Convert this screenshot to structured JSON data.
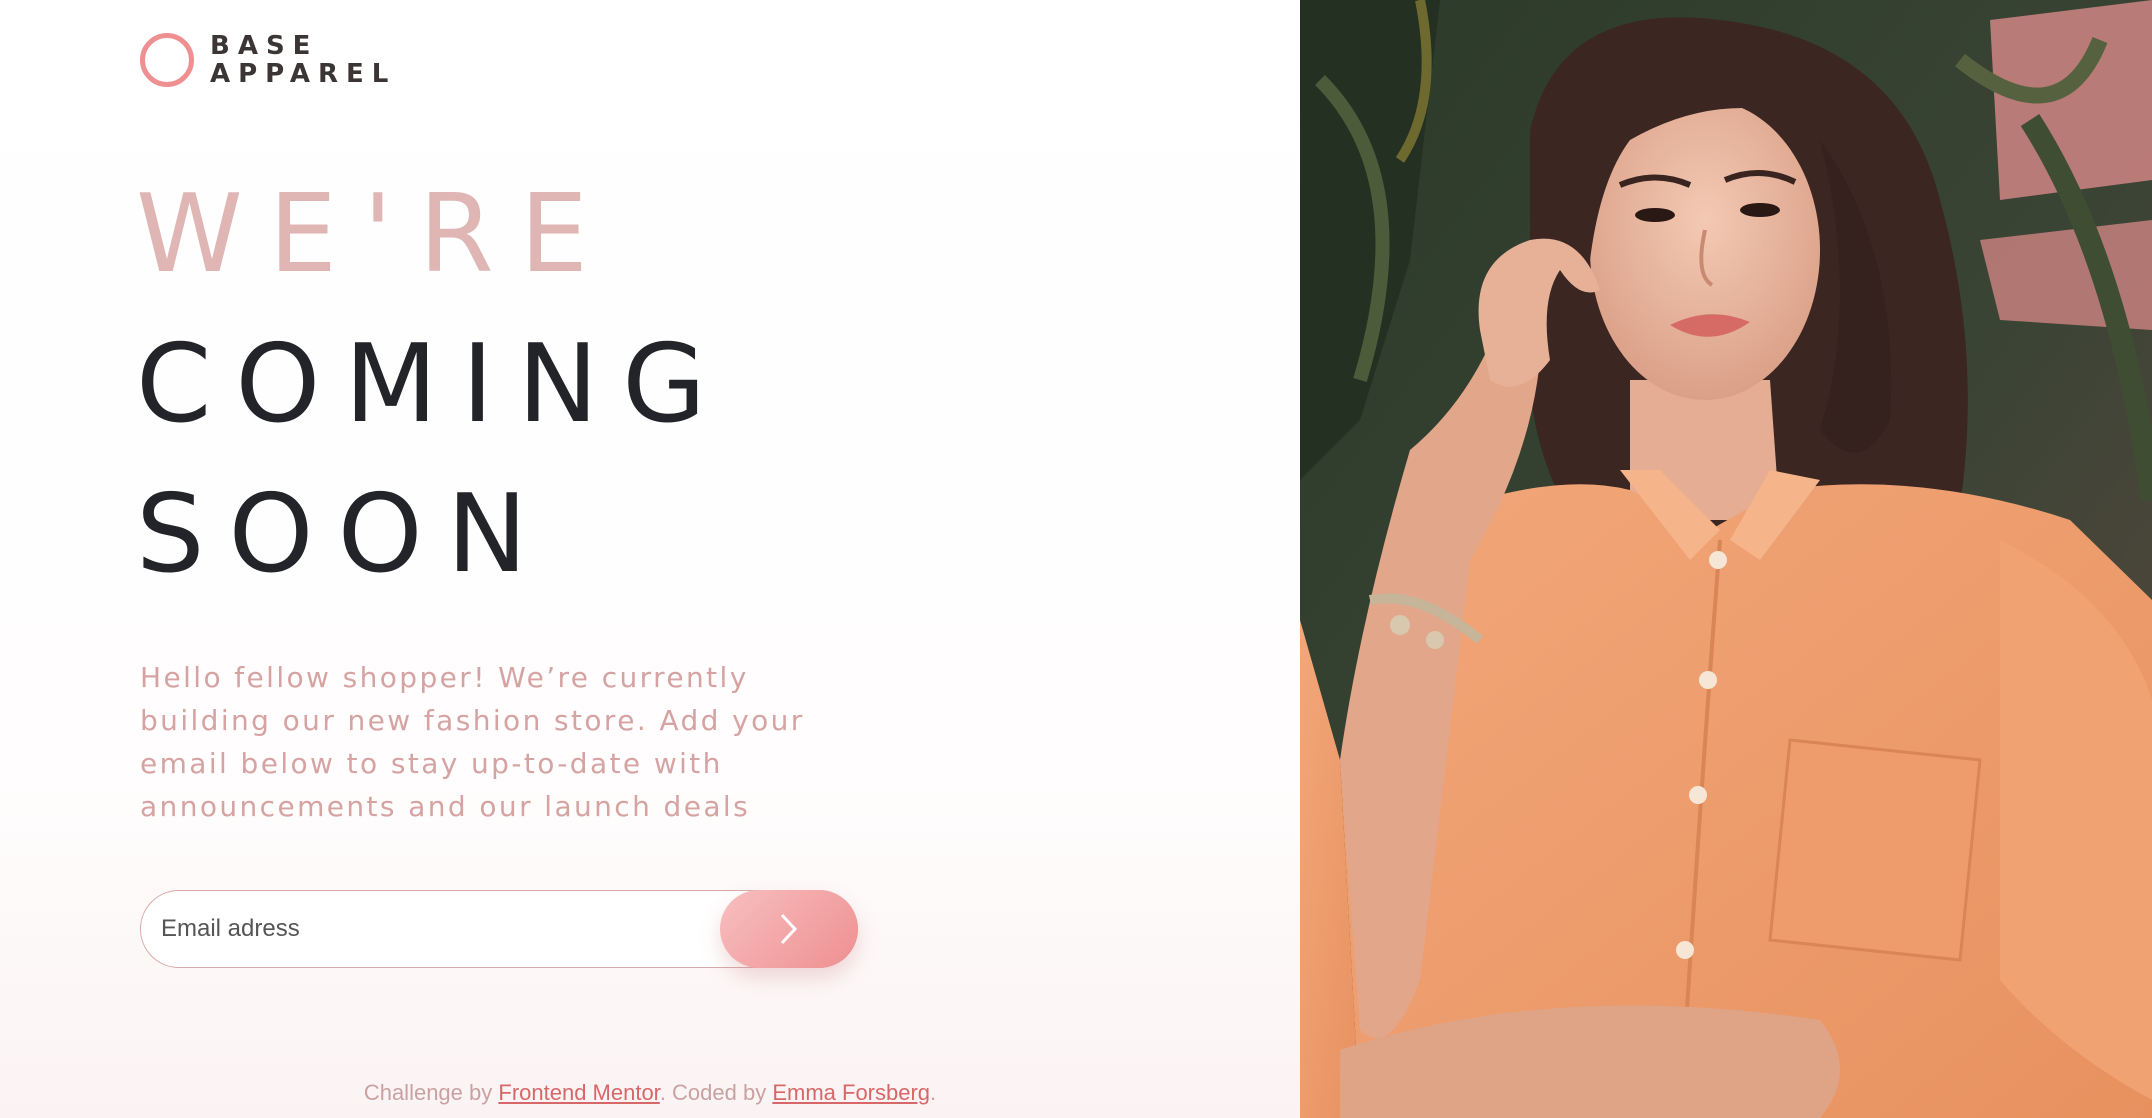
{
  "brand": {
    "line1": "BASE",
    "line2": "APPAREL",
    "accent_color": "#ee8f91"
  },
  "hero": {
    "line1": "WE'RE",
    "line2": "COMING",
    "line3": "SOON"
  },
  "intro": "Hello fellow shopper! We’re currently building our new fashion store. Add your email below to stay up-to-date with announcements and our launch deals",
  "form": {
    "email_placeholder": "Email adress",
    "submit_icon": "chevron-right-icon"
  },
  "footer": {
    "prefix": "Challenge by ",
    "link1": "Frontend Mentor",
    "middle": ". Coded by ",
    "link2": "Emma Forsberg",
    "suffix": "."
  },
  "colors": {
    "heading_light": "#dfb6b4",
    "heading_dark": "#23232a",
    "text_muted": "#d6a3a3",
    "link": "#d8676a"
  }
}
